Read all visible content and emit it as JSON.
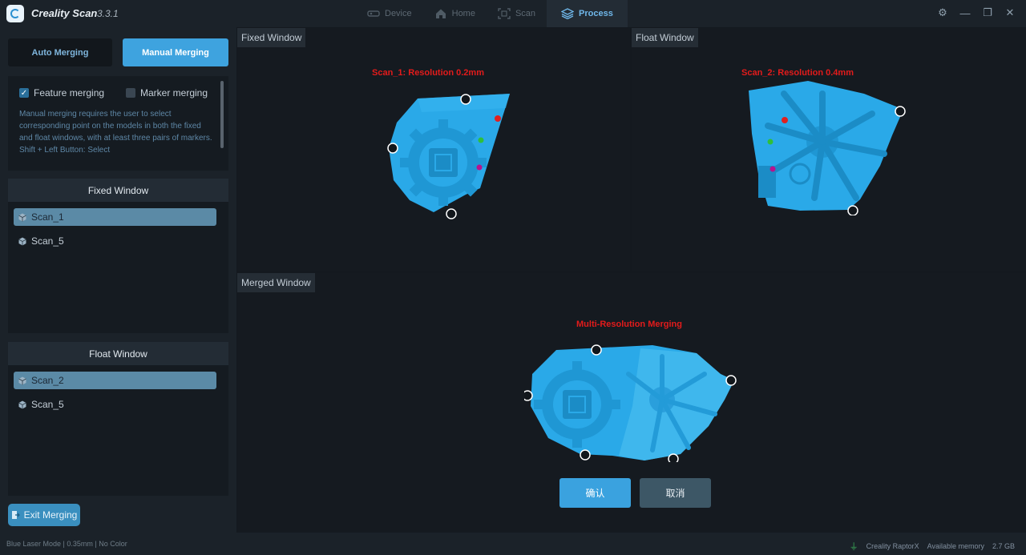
{
  "app": {
    "title": "Creality Scan",
    "version": "3.3.1"
  },
  "nav": [
    {
      "label": "Device",
      "icon": "device-icon",
      "active": false
    },
    {
      "label": "Home",
      "icon": "home-icon",
      "active": false
    },
    {
      "label": "Scan",
      "icon": "scan-icon",
      "active": false
    },
    {
      "label": "Process",
      "icon": "layers-icon",
      "active": true
    }
  ],
  "left": {
    "auto_label": "Auto Merging",
    "manual_label": "Manual Merging",
    "feature_label": "Feature merging",
    "feature_checked": true,
    "marker_label": "Marker merging",
    "marker_checked": false,
    "help_1": "Manual merging requires the user to select corresponding point on the models in both the fixed and float windows, with at least three pairs of markers.",
    "help_2": "Shift + Left Button: Select",
    "fixed_header": "Fixed Window",
    "fixed_items": [
      "Scan_1",
      "Scan_5"
    ],
    "float_header": "Float Window",
    "float_items": [
      "Scan_2",
      "Scan_5"
    ],
    "exit_label": "Exit Merging"
  },
  "views": {
    "fixed_label": "Fixed Window",
    "fixed_caption": "Scan_1: Resolution 0.2mm",
    "float_label": "Float Window",
    "float_caption": "Scan_2: Resolution 0.4mm",
    "merged_label": "Merged Window",
    "merged_caption": "Multi-Resolution Merging"
  },
  "actions": {
    "confirm": "确认",
    "cancel": "取消"
  },
  "status": {
    "left": "Blue Laser Mode | 0.35mm | No Color",
    "device": "Creality RaptorX",
    "memory_label": "Available memory",
    "memory_value": "2.7 GB"
  },
  "colors": {
    "accent": "#3ea3df",
    "model": "#2aa9e8",
    "caption": "#e31b1b",
    "bg": "#151a20"
  }
}
